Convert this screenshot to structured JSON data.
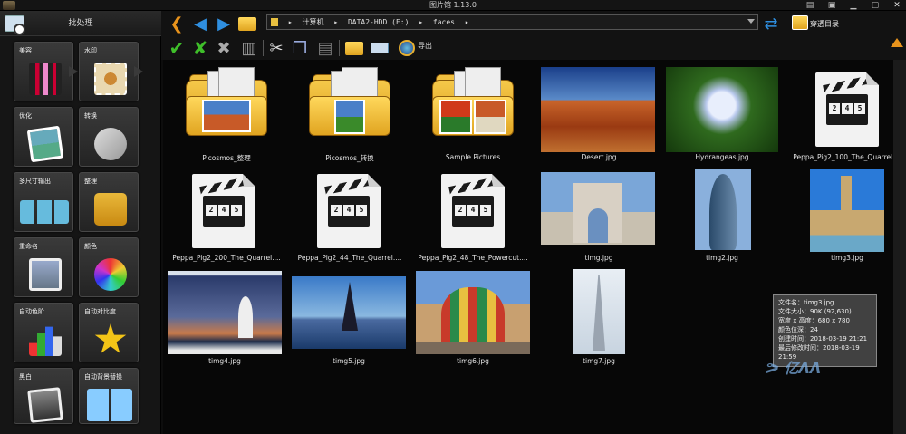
{
  "window": {
    "title": "图片馆 1.13.0"
  },
  "sidebar": {
    "header_label": "批处理",
    "tiles": [
      {
        "label": "美容"
      },
      {
        "label": "水印"
      },
      {
        "label": "优化"
      },
      {
        "label": "转换"
      },
      {
        "label": "多尺寸输出"
      },
      {
        "label": "整理"
      },
      {
        "label": "重命名"
      },
      {
        "label": "颜色"
      },
      {
        "label": "自动色阶"
      },
      {
        "label": "自动对比度"
      },
      {
        "label": "黑白"
      },
      {
        "label": "自动背景替换"
      }
    ]
  },
  "address": {
    "crumbs": [
      "计算机",
      "DATA2-HDD (E:)",
      "faces"
    ]
  },
  "toolbar": {
    "export_label": "导出",
    "through_dir_label": "穿透目录"
  },
  "files": {
    "items": [
      {
        "name": "Picosmos_整理",
        "kind": "folder"
      },
      {
        "name": "Picosmos_转换",
        "kind": "folder"
      },
      {
        "name": "Sample Pictures",
        "kind": "folder"
      },
      {
        "name": "Desert.jpg",
        "kind": "image"
      },
      {
        "name": "Hydrangeas.jpg",
        "kind": "image"
      },
      {
        "name": "Peppa_Pig2_100_The_Quarrel....",
        "kind": "video"
      },
      {
        "name": "Peppa_Pig2_200_The_Quarrel....",
        "kind": "video"
      },
      {
        "name": "Peppa_Pig2_44_The_Quarrel....",
        "kind": "video"
      },
      {
        "name": "Peppa_Pig2_48_The_Powercut....",
        "kind": "video"
      },
      {
        "name": "timg.jpg",
        "kind": "image"
      },
      {
        "name": "timg2.jpg",
        "kind": "image"
      },
      {
        "name": "timg3.jpg",
        "kind": "image"
      },
      {
        "name": "timg4.jpg",
        "kind": "image"
      },
      {
        "name": "timg5.jpg",
        "kind": "image"
      },
      {
        "name": "timg6.jpg",
        "kind": "image"
      },
      {
        "name": "timg7.jpg",
        "kind": "image"
      }
    ],
    "clapper_digits": [
      "2",
      "4",
      "5"
    ]
  },
  "tooltip": {
    "lines": [
      "文件名：timg3.jpg",
      "文件大小：90K (92,630)",
      "宽度 x 高度：680 x 780",
      "颜色位深：24",
      "创建时间：2018-03-19 21:21",
      "最后修改时间：2018-03-19 21:59"
    ]
  },
  "colors": {
    "accent_orange": "#e8931c",
    "nav_blue": "#2f8fe0",
    "background": "#070707"
  }
}
